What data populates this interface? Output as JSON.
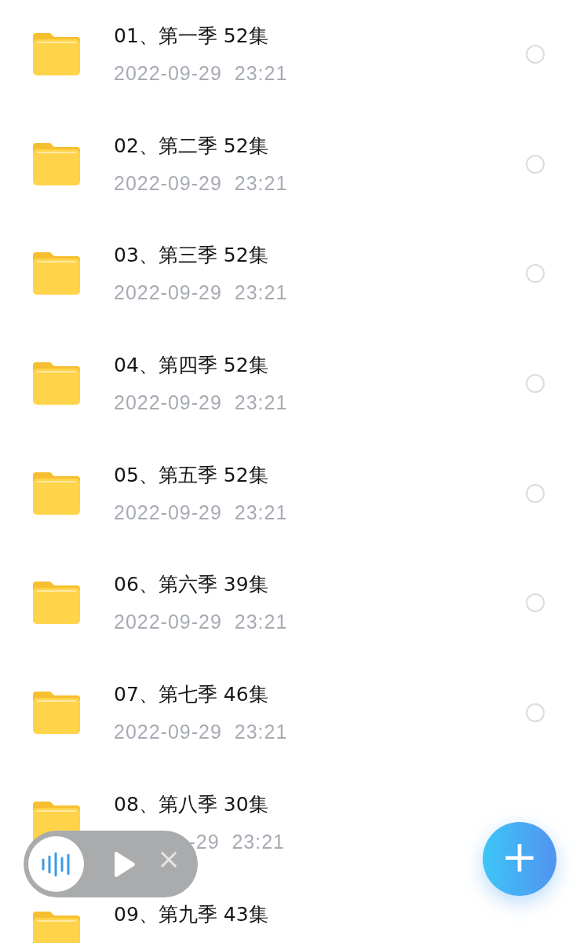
{
  "files": [
    {
      "name": "01、第一季 52集",
      "date": "2022-09-29  23:21",
      "selected": false
    },
    {
      "name": "02、第二季 52集",
      "date": "2022-09-29  23:21",
      "selected": false
    },
    {
      "name": "03、第三季 52集",
      "date": "2022-09-29  23:21",
      "selected": false
    },
    {
      "name": "04、第四季 52集",
      "date": "2022-09-29  23:21",
      "selected": false
    },
    {
      "name": "05、第五季 52集",
      "date": "2022-09-29  23:21",
      "selected": false
    },
    {
      "name": "06、第六季 39集",
      "date": "2022-09-29  23:21",
      "selected": false
    },
    {
      "name": "07、第七季 46集",
      "date": "2022-09-29  23:21",
      "selected": false
    },
    {
      "name": "08、第八季 30集",
      "date": "-29  23:21"
    },
    {
      "name": "09、第九季 43集"
    }
  ],
  "player": {
    "close": "×"
  },
  "fab": {
    "label": "+"
  }
}
